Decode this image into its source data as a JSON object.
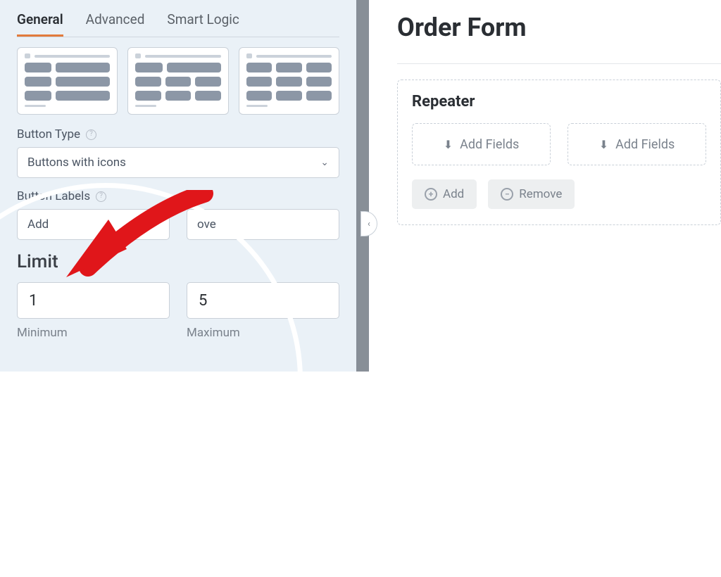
{
  "tabs": {
    "general": "General",
    "advanced": "Advanced",
    "smart": "Smart Logic"
  },
  "fields": {
    "button_type": {
      "label": "Button Type",
      "value": "Buttons with icons"
    },
    "button_labels": {
      "label": "Button Labels",
      "add": "Add",
      "remove": "ove"
    }
  },
  "limit": {
    "title": "Limit",
    "min_value": "1",
    "min_label": "Minimum",
    "max_value": "5",
    "max_label": "Maximum"
  },
  "form": {
    "title": "Order Form",
    "repeater": {
      "title": "Repeater",
      "slot_label": "Add Fields",
      "add": "Add",
      "remove": "Remove"
    }
  }
}
